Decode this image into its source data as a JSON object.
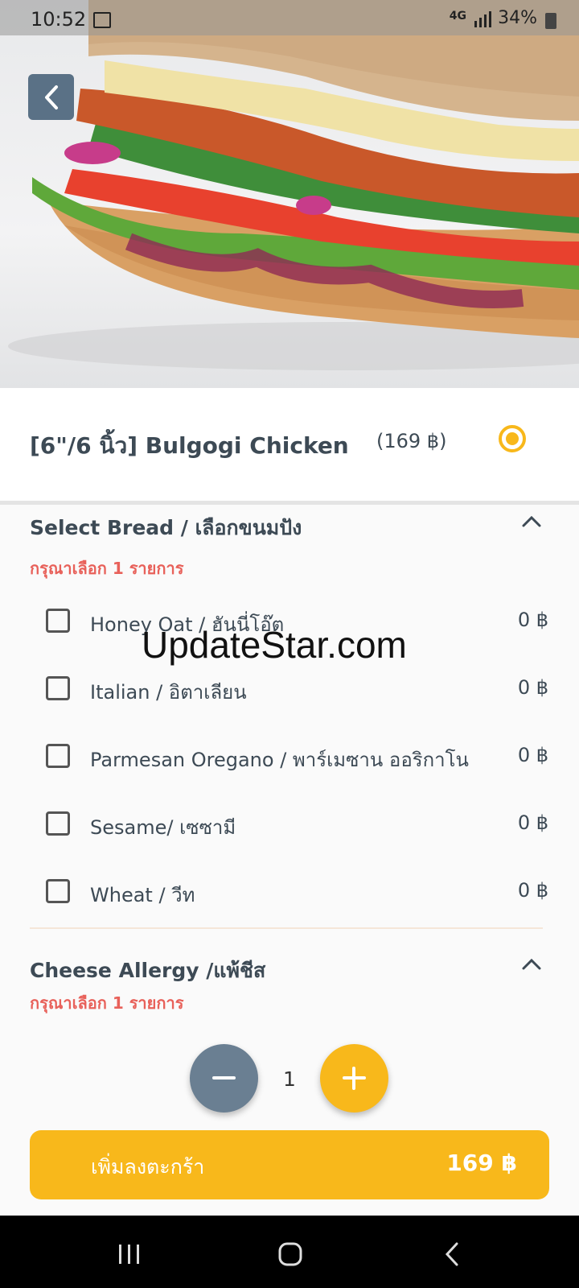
{
  "status": {
    "time": "10:52",
    "network": "4G",
    "battery": "34%"
  },
  "product": {
    "name": "[6\"/6 นิ้ว] Bulgogi Chicken",
    "price": "(169 ฿)"
  },
  "bread_section": {
    "title": "Select Bread / เลือกขนมปัง",
    "subtitle": "กรุณาเลือก 1 รายการ",
    "options": [
      {
        "label": "Honey Oat / ฮันนี่โอ๊ต",
        "price": "0 ฿"
      },
      {
        "label": "Italian / อิตาเลียน",
        "price": "0 ฿"
      },
      {
        "label": "Parmesan Oregano / พาร์เมซาน ออริกาโน",
        "price": "0 ฿"
      },
      {
        "label": "Sesame/ เซซามี",
        "price": "0 ฿"
      },
      {
        "label": "Wheat / วีท",
        "price": "0 ฿"
      }
    ]
  },
  "cheese_section": {
    "title": "Cheese Allergy /แพ้ชีส",
    "subtitle": "กรุณาเลือก 1 รายการ"
  },
  "watermark": "UpdateStar.com",
  "quantity": "1",
  "cart": {
    "label": "เพิ่มลงตะกร้า",
    "total": "169 ฿"
  },
  "colors": {
    "accent": "#f8b81b",
    "secondary": "#6a7f92",
    "required": "#e8615a",
    "text": "#3d4a55"
  }
}
